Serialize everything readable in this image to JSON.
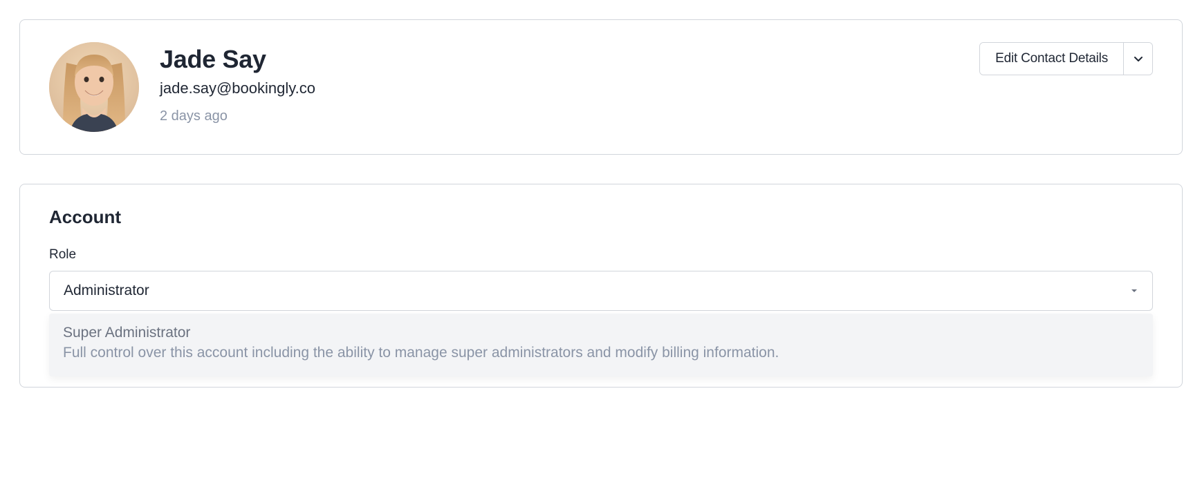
{
  "profile": {
    "name": "Jade Say",
    "email": "jade.say@bookingly.co",
    "last_active": "2 days ago",
    "edit_button_label": "Edit Contact Details"
  },
  "account": {
    "section_title": "Account",
    "role_label": "Role",
    "role_selected": "Administrator",
    "dropdown": {
      "option_title": "Super Administrator",
      "option_description": "Full control over this account including the ability to manage super administrators and modify billing information."
    }
  }
}
